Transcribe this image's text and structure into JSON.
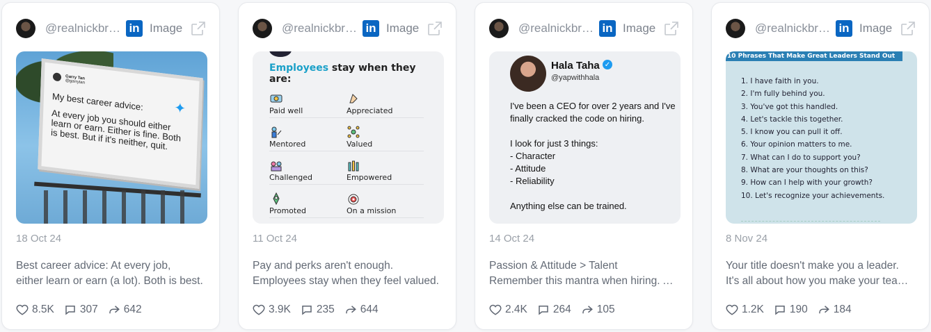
{
  "cards": [
    {
      "handle": "@realnickbright",
      "platform_logo": "in",
      "type": "Image",
      "date": "18 Oct 24",
      "caption": [
        "Best career advice: At every job,",
        "either learn or earn (a lot). Both is best."
      ],
      "likes": "8.5K",
      "comments": "307",
      "shares": "642",
      "media": {
        "tweet_name": "Garry Tan",
        "tweet_handle": "@garrytan",
        "line1": "My best career advice:",
        "body": "At every job you should either learn or earn. Either is fine. Both is best. But if it's neither, quit."
      }
    },
    {
      "handle": "@realnickbright",
      "platform_logo": "in",
      "type": "Image",
      "date": "11 Oct 24",
      "caption": [
        "Pay and perks aren't enough.",
        "Employees stay when they feel valued."
      ],
      "likes": "3.9K",
      "comments": "235",
      "shares": "644",
      "media": {
        "heading_highlight": "Employees",
        "heading_rest": " stay when they are:",
        "items": [
          "Paid well",
          "Appreciated",
          "Mentored",
          "Valued",
          "Challenged",
          "Empowered",
          "Promoted",
          "On a mission"
        ]
      }
    },
    {
      "handle": "@realnickbright",
      "platform_logo": "in",
      "type": "Image",
      "date": "14 Oct 24",
      "caption": [
        "Passion & Attitude > Talent",
        "Remember this mantra when hiring. Always."
      ],
      "likes": "2.4K",
      "comments": "264",
      "shares": "105",
      "media": {
        "name": "Hala Taha",
        "handle": "@yapwithhala",
        "text": "I've been a CEO for over 2 years and I've finally cracked the code on hiring.\n\nI look for just 3 things:\n- Character\n- Attitude\n- Reliability\n\nAnything else can be trained."
      }
    },
    {
      "handle": "@realnickbright",
      "platform_logo": "in",
      "type": "Image",
      "date": "8 Nov 24",
      "caption": [
        "Your title doesn't make you a leader.",
        "It's all about how you make your team feel."
      ],
      "likes": "1.2K",
      "comments": "190",
      "shares": "184",
      "media": {
        "banner": "10 Phrases That Make Great Leaders Stand Out",
        "phrases": [
          "1. I have faith in you.",
          "2. I'm fully behind you.",
          "3. You've got this handled.",
          "4. Let's tackle this together.",
          "5. I know you can pull it off.",
          "6. Your opinion matters to me.",
          "7. What can I do to support you?",
          "8. What are your thoughts on this?",
          "9. How can I help with your growth?",
          "10. Let's recognize your achievements."
        ]
      }
    }
  ],
  "colors": {
    "linkedin": "#0a66c2",
    "accent_blue": "#1aa0c8",
    "twitter": "#1d9bf0"
  }
}
